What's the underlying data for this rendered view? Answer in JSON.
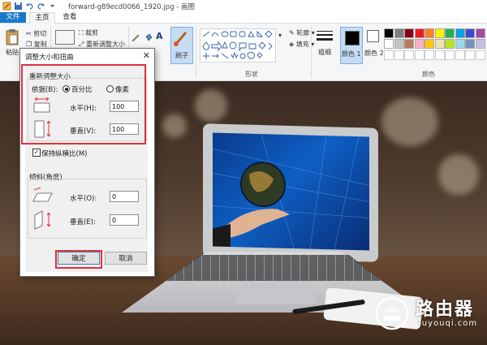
{
  "window": {
    "title": "forward-g89ecd0066_1920.jpg - 画图"
  },
  "tabs": {
    "file": "文件",
    "home": "主页",
    "view": "查看"
  },
  "ribbon": {
    "paste": "粘贴",
    "cut": "剪切",
    "copy": "复制",
    "crop": "裁剪",
    "resize": "重新调整大小",
    "brush": "刷子",
    "shapes_group": "形状",
    "outline": "轮廓",
    "fill": "填充",
    "size": "粗细",
    "color1": "颜色 1",
    "color2": "颜色 2",
    "colors_group": "颜色",
    "palette": [
      "#000000",
      "#7f7f7f",
      "#880015",
      "#ed1c24",
      "#ff7f27",
      "#fff200",
      "#22b14c",
      "#00a2e8",
      "#3f48cc",
      "#a349a4",
      "#ffffff",
      "#c3c3c3",
      "#b97a57",
      "#ffaec9",
      "#ffc90e",
      "#efe4b0",
      "#b5e61d",
      "#99d9ea",
      "#7092be",
      "#c8bfe7"
    ]
  },
  "dialog": {
    "title": "调整大小和扭曲",
    "resize_section": "重新调整大小",
    "by_label": "依据(B):",
    "percent_label": "百分比",
    "pixels_label": "像素",
    "horizontal_label": "水平(H):",
    "horizontal_value": "100",
    "vertical_label": "垂直(V):",
    "vertical_value": "100",
    "keep_ratio_label": "保持纵横比(M)",
    "skew_section": "倾斜(角度)",
    "skew_h_label": "水平(O):",
    "skew_h_value": "0",
    "skew_v_label": "垂直(E):",
    "skew_v_value": "0",
    "ok": "确定",
    "cancel": "取消"
  },
  "watermark": {
    "main": "路由器",
    "sub": "luyouqi.com"
  },
  "colors": {
    "accent": "#1979ca",
    "highlight": "#e0303e"
  }
}
